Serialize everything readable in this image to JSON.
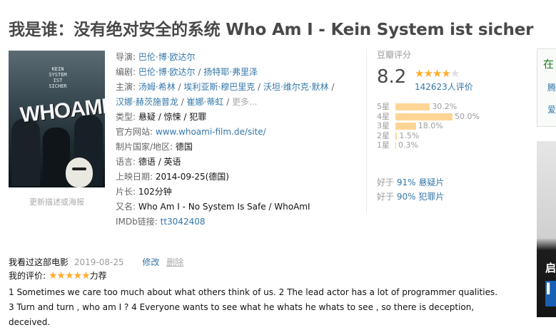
{
  "title": "我是谁：没有绝对安全的系统 Who Am I - Kein System ist sicher",
  "poster": {
    "lines": [
      "KEIN",
      "SYSTEM",
      "IST",
      "SICHER"
    ],
    "big": "WHOAMI",
    "link": "更新描述或海报"
  },
  "info": {
    "director_label": "导演:",
    "director": "巴伦·博·欧达尔",
    "writer_label": "编剧:",
    "writers": [
      "巴伦·博·欧达尔",
      "扬特耶·弗里泽"
    ],
    "cast_label": "主演:",
    "cast": [
      "汤姆·希林",
      "埃利亚斯·穆巴里克",
      "沃坦·维尔克·默林",
      "汉娜·赫茨施普龙",
      "崔娜·蒂虹"
    ],
    "more": "更多...",
    "genre_label": "类型:",
    "genre": "悬疑 / 惊悚 / 犯罪",
    "site_label": "官方网站:",
    "site": "www.whoami-film.de/site/",
    "country_label": "制片国家/地区:",
    "country": "德国",
    "lang_label": "语言:",
    "lang": "德语 / 英语",
    "release_label": "上映日期:",
    "release": "2014-09-25(德国)",
    "runtime_label": "片长:",
    "runtime": "102分钟",
    "aka_label": "又名:",
    "aka": "Who Am I - No System Is Safe / WhoAmI",
    "imdb_label": "IMDb链接:",
    "imdb": "tt3042408",
    "sep": " / "
  },
  "rating": {
    "title": "豆瓣评分",
    "score": "8.2",
    "stars": 4,
    "votes": "142623人评价",
    "bars": [
      {
        "label": "5星",
        "pct": 30.2,
        "text": "30.2%"
      },
      {
        "label": "4星",
        "pct": 50.0,
        "text": "50.0%"
      },
      {
        "label": "3星",
        "pct": 18.0,
        "text": "18.0%"
      },
      {
        "label": "2星",
        "pct": 1.5,
        "text": "1.5%"
      },
      {
        "label": "1星",
        "pct": 0.3,
        "text": "0.3%"
      }
    ],
    "better": [
      {
        "prefix": "好于",
        "pct": "91%",
        "cat": "悬疑片"
      },
      {
        "prefix": "好于",
        "pct": "90%",
        "cat": "犯罪片"
      }
    ]
  },
  "side": {
    "box_title": "在",
    "box_link1": "腾",
    "box_link2": "爱",
    "img_text": "启",
    "img_logo": "I"
  },
  "user": {
    "watched": "我看过这部电影",
    "date": "2019-08-25",
    "edit": "修改",
    "delete": "删除",
    "my_rating_label": "我的评价:",
    "my_stars": "★★★★★",
    "my_rating_word": "力荐",
    "comment": "1 Sometimes we care too much about what others think of us. 2 The lead actor has a lot of programmer qualities. 3 Turn and turn , who am I ? 4 Everyone wants to see what he whats he whats to see , so there is deception, deceived."
  },
  "colors": {
    "link": "#3377aa",
    "star": "#ffac2d",
    "bar": "#ffd596",
    "title": "#494949"
  }
}
